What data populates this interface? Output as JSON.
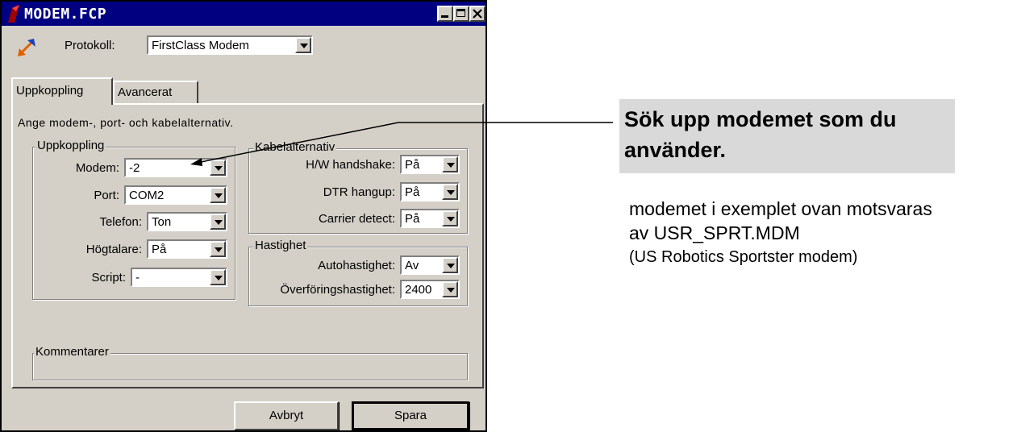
{
  "window": {
    "title": "MODEM.FCP",
    "protocol_label": "Protokoll:",
    "protocol_value": "FirstClass Modem",
    "tabs": [
      {
        "label": "Uppkoppling"
      },
      {
        "label": "Avancerat"
      }
    ],
    "description": "Ange modem-, port- och kabelalternativ.",
    "uppkoppling": {
      "title": "Uppkoppling",
      "fields": [
        {
          "label": "Modem:",
          "value": "-2"
        },
        {
          "label": "Port:",
          "value": "COM2"
        },
        {
          "label": "Telefon:",
          "value": "Ton"
        },
        {
          "label": "Högtalare:",
          "value": "På"
        },
        {
          "label": "Script:",
          "value": "-"
        }
      ]
    },
    "kabel": {
      "title": "Kabelalternativ",
      "fields": [
        {
          "label": "H/W handshake:",
          "value": "På"
        },
        {
          "label": "DTR hangup:",
          "value": "På"
        },
        {
          "label": "Carrier detect:",
          "value": "På"
        }
      ]
    },
    "hastighet": {
      "title": "Hastighet",
      "fields": [
        {
          "label": "Autohastighet:",
          "value": "Av"
        },
        {
          "label": "Överföringshastighet:",
          "value": "2400"
        }
      ]
    },
    "kommentarer": {
      "title": "Kommentarer"
    },
    "buttons": {
      "cancel": "Avbryt",
      "save": "Spara"
    },
    "colors": {
      "titlebar": "#000080",
      "face": "#d4d0c8",
      "callout": "#d9d9d9"
    }
  },
  "annotation": {
    "callout": "Sök upp modemet som du använder.",
    "note_line1": "modemet i exemplet ovan motsvaras",
    "note_line2": "av USR_SPRT.MDM",
    "note_line3": "(US Robotics Sportster modem)"
  }
}
